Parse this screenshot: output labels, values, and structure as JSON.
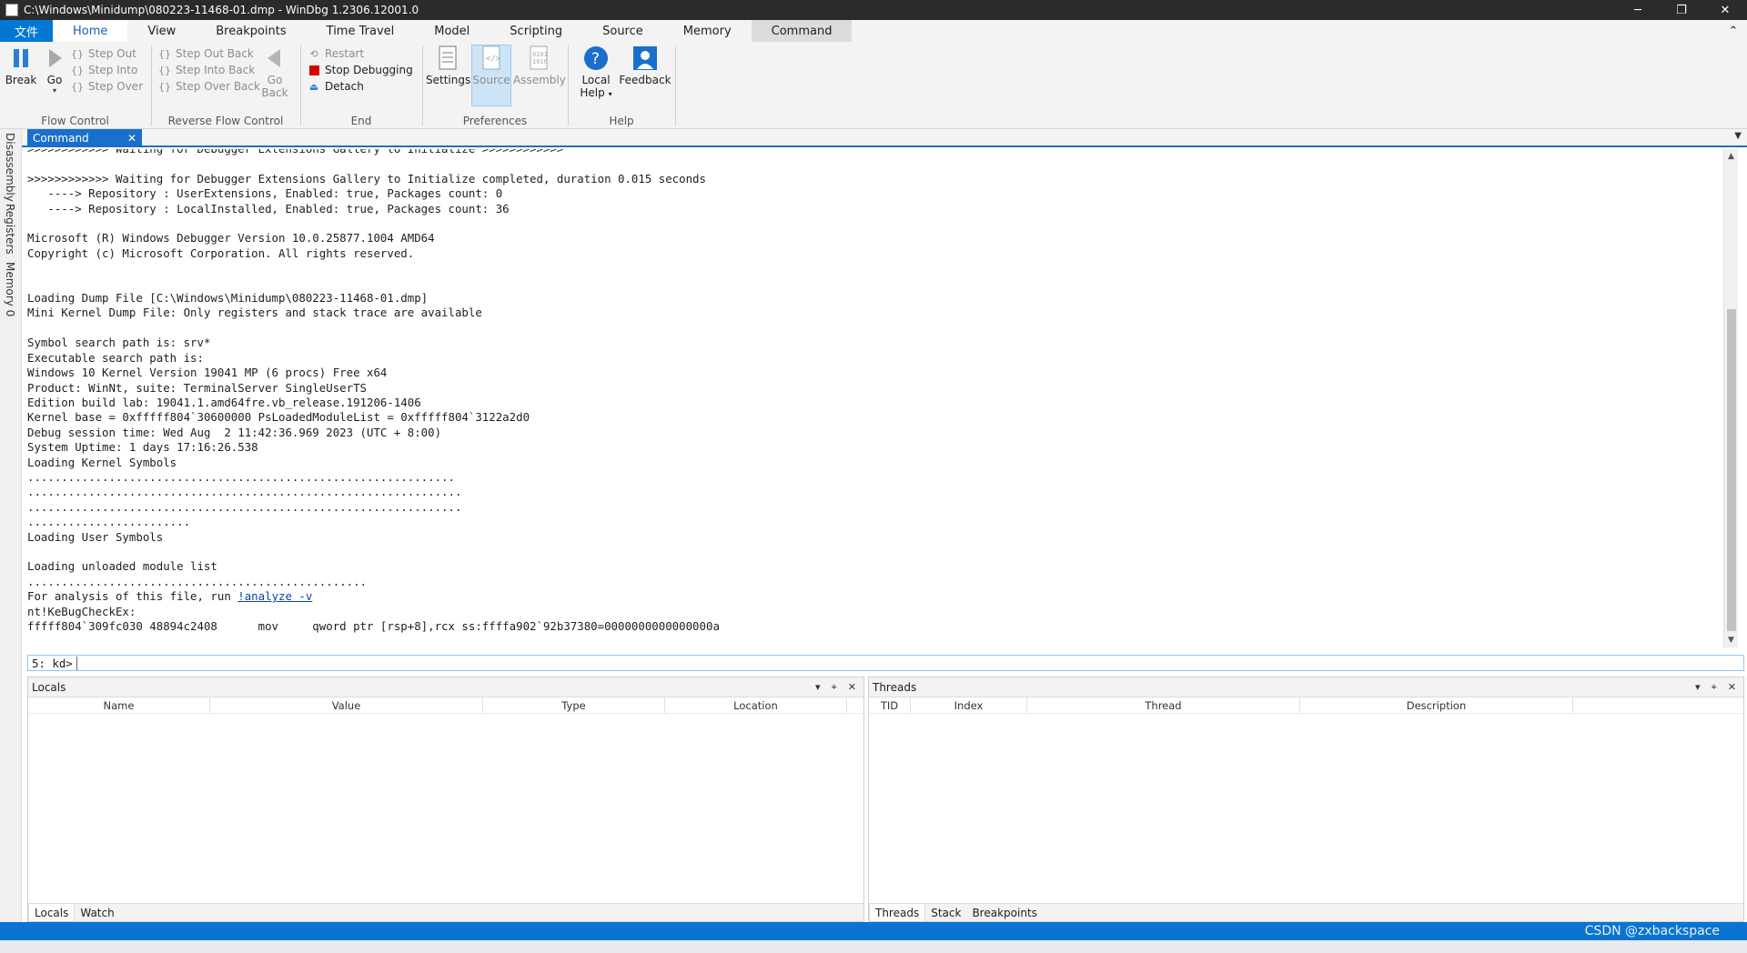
{
  "window": {
    "title": "C:\\Windows\\Minidump\\080223-11468-01.dmp - WinDbg 1.2306.12001.0",
    "minimize_glyph": "─",
    "maximize_glyph": "❐",
    "close_glyph": "✕"
  },
  "ribbon_tabs": {
    "file": "文件",
    "items": [
      "Home",
      "View",
      "Breakpoints",
      "Time Travel",
      "Model",
      "Scripting",
      "Source",
      "Memory",
      "Command"
    ],
    "active": "Home",
    "highlighted": "Command",
    "collapse_glyph": "⌃"
  },
  "ribbon": {
    "flow_control": {
      "label": "Flow Control",
      "break": "Break",
      "go": "Go",
      "step_out": "Step Out",
      "step_into": "Step Into",
      "step_over": "Step Over"
    },
    "reverse_flow_control": {
      "label": "Reverse Flow Control",
      "step_out_back": "Step Out Back",
      "step_into_back": "Step Into Back",
      "step_over_back": "Step Over Back",
      "go_back_1": "Go",
      "go_back_2": "Back"
    },
    "end": {
      "label": "End",
      "restart": "Restart",
      "stop_debugging": "Stop Debugging",
      "detach": "Detach"
    },
    "preferences": {
      "label": "Preferences",
      "settings": "Settings",
      "source": "Source",
      "assembly": "Assembly"
    },
    "help": {
      "label": "Help",
      "local_help_1": "Local",
      "local_help_2": "Help",
      "feedback": "Feedback"
    }
  },
  "left_dock": {
    "tabs": [
      "Disassembly",
      "Registers",
      "Memory 0"
    ]
  },
  "command_window": {
    "tab_label": "Command",
    "close_glyph": "✕",
    "truncated_top_line": ">>>>>>>>>>>> Waiting for Debugger Extensions Gallery to Initialize >>>>>>>>>>>>",
    "lines": [
      "",
      ">>>>>>>>>>>> Waiting for Debugger Extensions Gallery to Initialize completed, duration 0.015 seconds",
      "   ----> Repository : UserExtensions, Enabled: true, Packages count: 0",
      "   ----> Repository : LocalInstalled, Enabled: true, Packages count: 36",
      "",
      "Microsoft (R) Windows Debugger Version 10.0.25877.1004 AMD64",
      "Copyright (c) Microsoft Corporation. All rights reserved.",
      "",
      "",
      "Loading Dump File [C:\\Windows\\Minidump\\080223-11468-01.dmp]",
      "Mini Kernel Dump File: Only registers and stack trace are available",
      "",
      "Symbol search path is: srv*",
      "Executable search path is:",
      "Windows 10 Kernel Version 19041 MP (6 procs) Free x64",
      "Product: WinNt, suite: TerminalServer SingleUserTS",
      "Edition build lab: 19041.1.amd64fre.vb_release.191206-1406",
      "Kernel base = 0xfffff804`30600000 PsLoadedModuleList = 0xfffff804`3122a2d0",
      "Debug session time: Wed Aug  2 11:42:36.969 2023 (UTC + 8:00)",
      "System Uptime: 1 days 17:16:26.538",
      "Loading Kernel Symbols",
      "...............................................................",
      "................................................................",
      "................................................................",
      "........................",
      "Loading User Symbols",
      "",
      "Loading unloaded module list",
      ".................................................."
    ],
    "analysis_prefix": "For analysis of this file, run ",
    "analysis_link": "!analyze -v",
    "lines_after": [
      "nt!KeBugCheckEx:",
      "fffff804`309fc030 48894c2408      mov     qword ptr [rsp+8],rcx ss:ffffa902`92b37380=0000000000000000a"
    ],
    "prompt": "5: kd>",
    "input_value": ""
  },
  "locals_pane": {
    "title": "Locals",
    "columns": [
      "Name",
      "Value",
      "Type",
      "Location"
    ],
    "tabs": [
      "Locals",
      "Watch"
    ],
    "active_tab": "Locals"
  },
  "threads_pane": {
    "title": "Threads",
    "columns": [
      "TID",
      "Index",
      "Thread",
      "Description"
    ],
    "tabs": [
      "Threads",
      "Stack",
      "Breakpoints"
    ],
    "active_tab": "Threads"
  },
  "pane_controls": {
    "dropdown": "▾",
    "pin": "⌖",
    "close": "✕"
  },
  "watermark": "CSDN @zxbackspace",
  "colors": {
    "accent": "#0078d4",
    "titlebar": "#2b2b2b",
    "statusbar": "#0a74d0",
    "stop_red": "#d40000"
  }
}
